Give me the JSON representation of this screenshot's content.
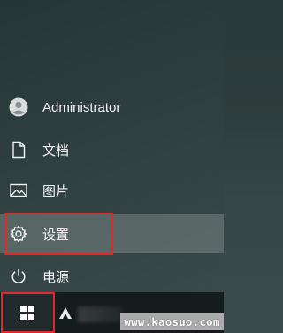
{
  "start_menu": {
    "items": [
      {
        "label": "Administrator",
        "icon": "user-avatar-icon"
      },
      {
        "label": "文档",
        "icon": "document-icon"
      },
      {
        "label": "图片",
        "icon": "picture-icon"
      },
      {
        "label": "设置",
        "icon": "gear-icon",
        "selected": true
      },
      {
        "label": "电源",
        "icon": "power-icon"
      }
    ]
  },
  "taskbar": {
    "start_icon": "windows-logo-icon",
    "pinned_icon": "app-icon"
  },
  "watermark": {
    "text": "www.kaosuo.com"
  },
  "colors": {
    "highlight": "#e0292c",
    "selected_bg": "#6f7b7b",
    "taskbar": "#151c1c"
  }
}
